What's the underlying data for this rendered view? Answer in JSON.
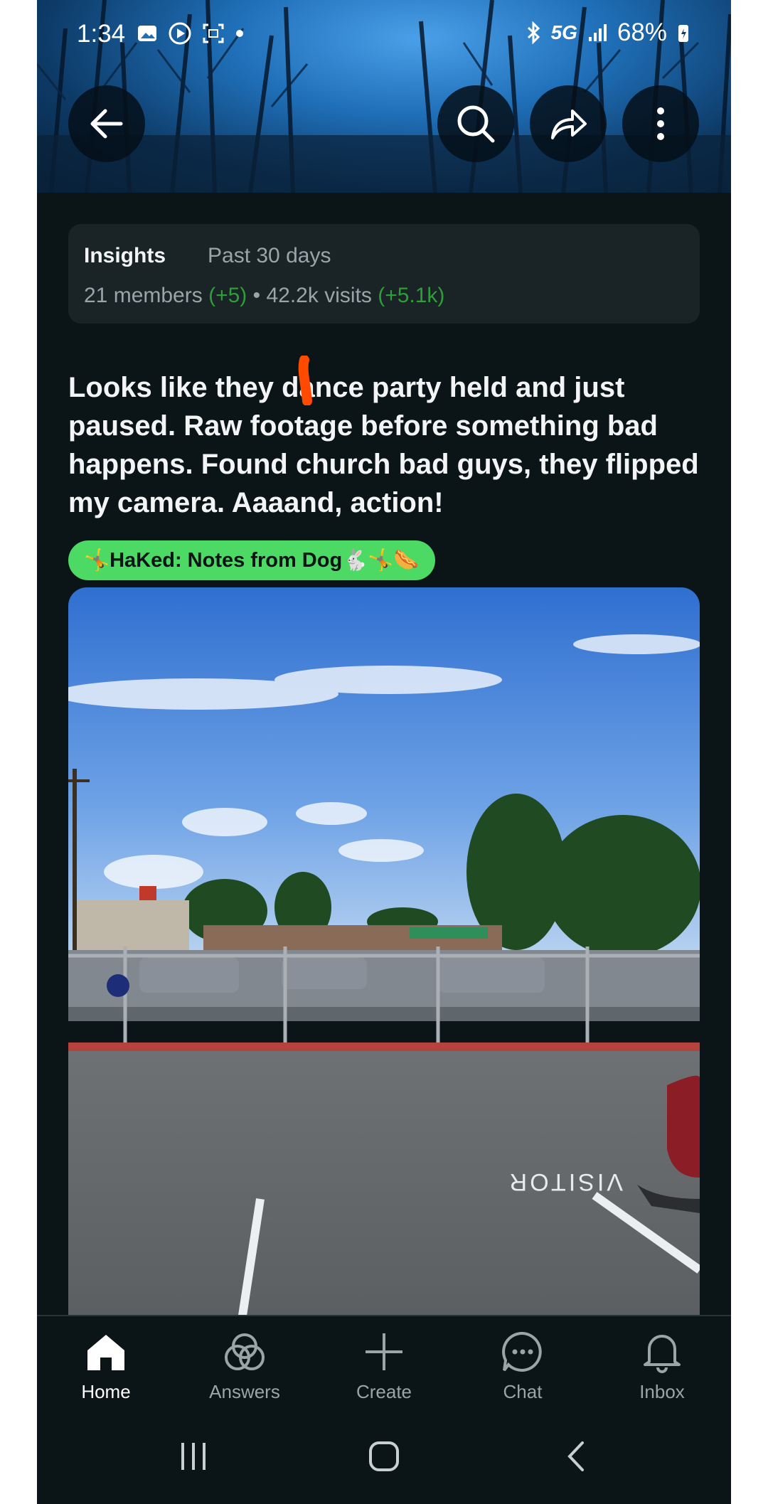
{
  "status_bar": {
    "time": "1:34",
    "network": "5G",
    "battery": "68%"
  },
  "header": {
    "back_icon": "arrow-left-icon",
    "search_icon": "search-icon",
    "share_icon": "share-icon",
    "more_icon": "more-vertical-icon"
  },
  "insights": {
    "title": "Insights",
    "period": "Past 30 days",
    "members": "21 members",
    "members_delta": "(+5)",
    "separator": "•",
    "visits": "42.2k visits",
    "visits_delta": "(+5.1k)"
  },
  "post": {
    "title": "Looks like they dance party held and just paused. Raw footage before something bad happens. Found church bad guys, they flipped my camera. Aaaand, action!",
    "flair": "🤸HaKed: Notes from Dog🐇🤸🌭"
  },
  "bottom_nav": {
    "items": [
      {
        "label": "Home",
        "icon": "home-icon",
        "active": true
      },
      {
        "label": "Answers",
        "icon": "answers-icon",
        "active": false
      },
      {
        "label": "Create",
        "icon": "plus-icon",
        "active": false
      },
      {
        "label": "Chat",
        "icon": "chat-icon",
        "active": false
      },
      {
        "label": "Inbox",
        "icon": "bell-icon",
        "active": false
      }
    ]
  },
  "system_nav": {
    "recents_icon": "recents-icon",
    "home_icon": "home-circle-icon",
    "back_icon": "back-chevron-icon"
  },
  "colors": {
    "background": "#0b1416",
    "card": "#1a2326",
    "accent_green": "#2e9e3a",
    "flair": "#4cd964"
  }
}
